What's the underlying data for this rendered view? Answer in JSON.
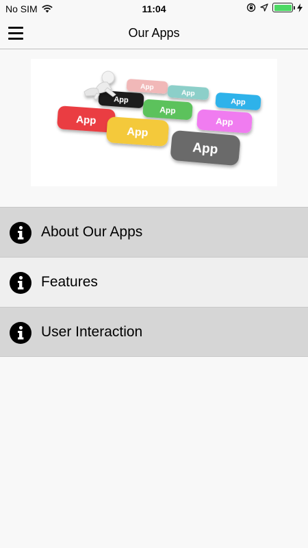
{
  "status_bar": {
    "carrier": "No SIM",
    "time": "11:04",
    "battery_level": 1.0,
    "battery_color": "#4cd964"
  },
  "header": {
    "title": "Our Apps",
    "menu_icon": "hamburger-menu-icon"
  },
  "banner": {
    "tile_label": "App"
  },
  "menu": {
    "items": [
      {
        "label": "About Our Apps",
        "icon": "info-icon"
      },
      {
        "label": "Features",
        "icon": "info-icon"
      },
      {
        "label": "User Interaction",
        "icon": "info-icon"
      }
    ]
  },
  "colors": {
    "background": "#f8f8f8",
    "row_dark": "#d6d6d6",
    "row_light": "#efefef"
  }
}
